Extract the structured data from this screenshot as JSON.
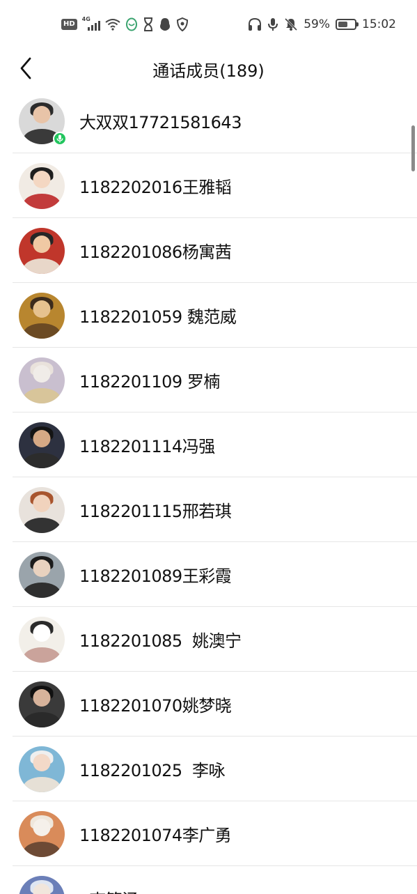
{
  "status_bar": {
    "hd_label": "HD",
    "network_label": "4G",
    "battery_percent": "59%",
    "battery_level": 0.59,
    "time": "15:02",
    "left_icons": [
      "hd-icon",
      "signal-icon",
      "wifi-icon",
      "qq-app-icon",
      "hourglass-icon",
      "penguin-icon",
      "shield-icon"
    ],
    "right_icons": [
      "headphones-icon",
      "microphone-icon",
      "bell-muted-icon",
      "battery-icon"
    ]
  },
  "header": {
    "title": "通话成员(189)",
    "back_icon": "chevron-left-icon"
  },
  "members": [
    {
      "name": "大双双17721581643",
      "speaking": true,
      "avatar_colors": [
        "#d9d9d9",
        "#2b2b2b",
        "#e8c4a8",
        "#3a3a3a"
      ]
    },
    {
      "name": "1182202016王雅韬",
      "speaking": false,
      "avatar_colors": [
        "#f1ebe4",
        "#1e1e1e",
        "#f4d7c2",
        "#c23b3b"
      ]
    },
    {
      "name": "1182201086杨寓茜",
      "speaking": false,
      "avatar_colors": [
        "#c0362b",
        "#262626",
        "#f0c9a4",
        "#e8d7c9"
      ]
    },
    {
      "name": "1182201059 魏范威",
      "speaking": false,
      "avatar_colors": [
        "#b8862f",
        "#3b2b1c",
        "#e6c28f",
        "#6b4a23"
      ]
    },
    {
      "name": "1182201109 罗楠",
      "speaking": false,
      "avatar_colors": [
        "#c9bfcf",
        "#e9e2dc",
        "#f0ece8",
        "#d8c59a"
      ]
    },
    {
      "name": "1182201114冯强",
      "speaking": false,
      "avatar_colors": [
        "#2d3140",
        "#141414",
        "#d6a985",
        "#2c2c2c"
      ]
    },
    {
      "name": "1182201115邢若琪",
      "speaking": false,
      "avatar_colors": [
        "#e8e2dc",
        "#a8552e",
        "#f1d3bd",
        "#333333"
      ]
    },
    {
      "name": "1182201089王彩霞",
      "speaking": false,
      "avatar_colors": [
        "#9aa4ab",
        "#1b1b1b",
        "#e9d2bf",
        "#2f2f2f"
      ]
    },
    {
      "name": "1182201085  姚澳宁",
      "speaking": false,
      "avatar_colors": [
        "#f2efe9",
        "#2a2a2a",
        "#ffffff",
        "#caa39b"
      ]
    },
    {
      "name": "1182201070姚梦晓",
      "speaking": false,
      "avatar_colors": [
        "#3a3a3a",
        "#111111",
        "#d7b39b",
        "#2a2a2a"
      ]
    },
    {
      "name": "1182201025  李咏",
      "speaking": false,
      "avatar_colors": [
        "#7fb7d6",
        "#efefef",
        "#f3d9c8",
        "#e6e0d6"
      ]
    },
    {
      "name": "1182201074李广勇",
      "speaking": false,
      "avatar_colors": [
        "#d98b5a",
        "#efe7dc",
        "#f5f0ea",
        "#6d4a35"
      ]
    },
    {
      "name": "  李管涵",
      "speaking": false,
      "avatar_colors": [
        "#6b7fb8",
        "#dfe6f2",
        "#f1e6dc",
        "#b6c3e0"
      ]
    }
  ],
  "icons": {
    "mic_badge": "microphone-icon",
    "colors": {
      "speaking_badge": "#22c55e",
      "divider": "#e6e6e6"
    }
  }
}
